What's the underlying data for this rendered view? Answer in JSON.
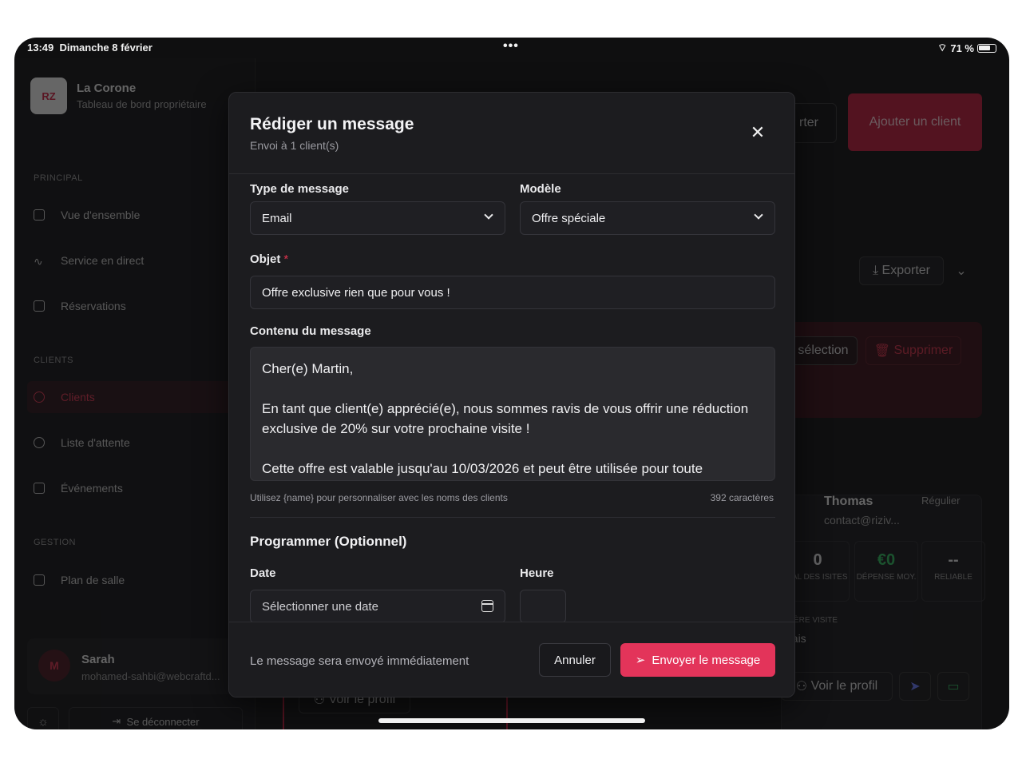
{
  "status_bar": {
    "time": "13:49",
    "date": "Dimanche 8 février",
    "battery": "71 %"
  },
  "sidebar": {
    "brand_name": "La Corone",
    "brand_sub": "Tableau de bord propriétaire",
    "logo_text": "RZ",
    "sections": {
      "principal": "PRINCIPAL",
      "clients": "CLIENTS",
      "gestion": "GESTION"
    },
    "items": [
      {
        "label": "Vue d'ensemble"
      },
      {
        "label": "Service en direct"
      },
      {
        "label": "Réservations"
      },
      {
        "label": "Clients"
      },
      {
        "label": "Liste d'attente"
      },
      {
        "label": "Événements"
      },
      {
        "label": "Plan de salle"
      }
    ],
    "user": {
      "initial": "M",
      "name": "Sarah",
      "email": "mohamed-sahbi@webcraftd..."
    },
    "logout": "Se déconnecter"
  },
  "background": {
    "add_client": "Ajouter un client",
    "export_top": "rter",
    "exporter": "Exporter",
    "selection": "sélection",
    "supprimer": "Supprimer",
    "client": {
      "name": "Thomas",
      "email": "contact@riziv...",
      "badge": "Régulier",
      "stats": [
        {
          "value": "0",
          "label": "TAL DES ISITES"
        },
        {
          "value": "€0",
          "label": "DÉPENSE MOY."
        },
        {
          "value": "--",
          "label": "RELIABLE"
        }
      ],
      "last_visit_label": "NIÈRE VISITE",
      "last_visit_value": "nais",
      "view_profile": "Voir le profil"
    },
    "view_profile_2": "Voir le profil"
  },
  "modal": {
    "title": "Rédiger un message",
    "subtitle": "Envoi à 1 client(s)",
    "type_label": "Type de message",
    "type_value": "Email",
    "template_label": "Modèle",
    "template_value": "Offre spéciale",
    "subject_label": "Objet",
    "subject_required": "*",
    "subject_value": "Offre exclusive rien que pour vous !",
    "content_label": "Contenu du message",
    "content_value": "Cher(e) Martin,\n\nEn tant que client(e) apprécié(e), nous sommes ravis de vous offrir une réduction exclusive de 20% sur votre prochaine visite !\n\nCette offre est valable jusqu'au 10/03/2026 et peut être utilisée pour toute",
    "hint_left": "Utilisez {name} pour personnaliser avec les noms des clients",
    "hint_right": "392 caractères",
    "schedule_title": "Programmer (Optionnel)",
    "date_label": "Date",
    "date_placeholder": "Sélectionner une date",
    "time_label": "Heure",
    "footer_note": "Le message sera envoyé immédiatement",
    "cancel": "Annuler",
    "send": "Envoyer le message"
  },
  "colors": {
    "accent": "#e3345a",
    "bg": "#0f0f10",
    "modal": "#1c1c1f"
  }
}
